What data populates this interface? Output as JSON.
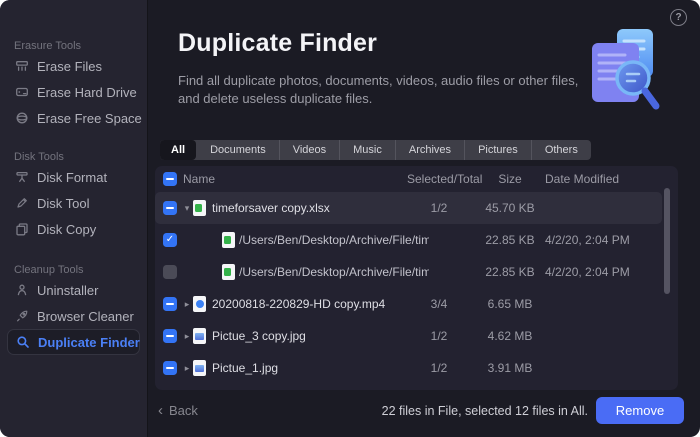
{
  "window": {
    "traffic_lights": [
      {
        "name": "close",
        "color": "#ee6a5f"
      },
      {
        "name": "minimize",
        "color": "#f5bf4e"
      },
      {
        "name": "zoom",
        "color": "#d9d9d9"
      }
    ],
    "help_glyph": "?"
  },
  "sidebar": {
    "selected_item": "Duplicate Finder",
    "sections": [
      {
        "label": "Erasure Tools",
        "items": [
          {
            "label": "Erase Files",
            "icon": "shredder-icon"
          },
          {
            "label": "Erase Hard Drive",
            "icon": "hard-drive-icon"
          },
          {
            "label": "Erase Free Space",
            "icon": "free-space-icon"
          }
        ]
      },
      {
        "label": "Disk Tools",
        "items": [
          {
            "label": "Disk Format",
            "icon": "disk-format-icon"
          },
          {
            "label": "Disk Tool",
            "icon": "disk-tool-icon"
          },
          {
            "label": "Disk Copy",
            "icon": "disk-copy-icon"
          }
        ]
      },
      {
        "label": "Cleanup Tools",
        "items": [
          {
            "label": "Uninstaller",
            "icon": "uninstaller-icon"
          },
          {
            "label": "Browser Cleaner",
            "icon": "browser-cleaner-icon"
          },
          {
            "label": "Duplicate Finder",
            "icon": "magnifier-icon"
          }
        ]
      }
    ]
  },
  "header": {
    "title": "Duplicate Finder",
    "description": "Find all duplicate photos, documents, videos, audio files or other files, and delete useless duplicate files."
  },
  "tabs": {
    "selected": "All",
    "items": [
      "All",
      "Documents",
      "Videos",
      "Music",
      "Archives",
      "Pictures",
      "Others"
    ]
  },
  "table": {
    "header_checkbox": "indeterminate",
    "columns": {
      "name": "Name",
      "selected_total": "Selected/Total",
      "size": "Size",
      "date_modified": "Date Modified"
    },
    "rows": [
      {
        "type": "parent",
        "highlighted": true,
        "checkbox": "indeterminate",
        "disclosure": "expanded",
        "file_icon": "excel-file-icon",
        "name": "timeforsaver copy.xlsx",
        "selected_total": "1/2",
        "size": "45.70 KB",
        "date_modified": ""
      },
      {
        "type": "child",
        "checkbox": "checked",
        "file_icon": "excel-file-icon",
        "name": "/Users/Ben/Desktop/Archive/File/timeforsav...",
        "selected_total": "",
        "size": "22.85 KB",
        "date_modified": "4/2/20, 2:04 PM"
      },
      {
        "type": "child",
        "checkbox": "unchecked",
        "file_icon": "excel-file-icon",
        "name": "/Users/Ben/Desktop/Archive/File/timeforsav...",
        "selected_total": "",
        "size": "22.85 KB",
        "date_modified": "4/2/20, 2:04 PM"
      },
      {
        "type": "parent",
        "checkbox": "indeterminate",
        "disclosure": "collapsed",
        "file_icon": "video-file-icon",
        "name": "20200818-220829-HD copy.mp4",
        "selected_total": "3/4",
        "size": "6.65 MB",
        "date_modified": ""
      },
      {
        "type": "parent",
        "checkbox": "indeterminate",
        "disclosure": "collapsed",
        "file_icon": "image-file-icon",
        "name": "Pictue_3 copy.jpg",
        "selected_total": "1/2",
        "size": "4.62 MB",
        "date_modified": ""
      },
      {
        "type": "parent",
        "checkbox": "indeterminate",
        "disclosure": "collapsed",
        "file_icon": "image-file-icon",
        "name": "Pictue_1.jpg",
        "selected_total": "1/2",
        "size": "3.91 MB",
        "date_modified": ""
      }
    ]
  },
  "footer": {
    "back_label": "Back",
    "status": "22 files in File, selected 12 files in All.",
    "remove_label": "Remove"
  },
  "colors": {
    "accent_blue": "#3374f5",
    "remove_button_blue": "#4a6cf5",
    "selected_text_blue": "#4b80f6",
    "window_bg": "#1b1b24",
    "sidebar_bg": "#252430",
    "panel_bg": "#232230",
    "row_highlight": "#2f2e3c"
  }
}
